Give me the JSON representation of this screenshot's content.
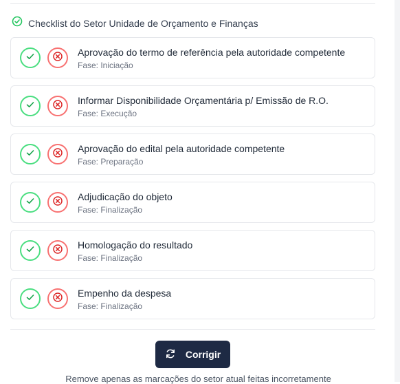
{
  "checklist": {
    "title": "Checklist do Setor Unidade de Orçamento e Finanças",
    "items": [
      {
        "title": "Aprovação do termo de referência pela autoridade competente",
        "phase": "Fase: Iniciação"
      },
      {
        "title": "Informar Disponibilidade Orçamentária p/ Emissão de R.O.",
        "phase": "Fase: Execução"
      },
      {
        "title": "Aprovação do edital pela autoridade competente",
        "phase": "Fase: Preparação"
      },
      {
        "title": "Adjudicação do objeto",
        "phase": "Fase: Finalização"
      },
      {
        "title": "Homologação do resultado",
        "phase": "Fase: Finalização"
      },
      {
        "title": "Empenho da despesa",
        "phase": "Fase: Finalização"
      }
    ]
  },
  "actions": {
    "corrigir_label": "Corrigir",
    "helper_text": "Remove apenas as marcações do setor atual feitas incorretamente"
  },
  "colors": {
    "approve": "#4ade80",
    "reject": "#f87171",
    "primary_button": "#1e2a44"
  },
  "icons": {
    "header": "circle-check-icon",
    "approve": "check-icon",
    "reject": "x-circle-icon",
    "corrigir": "refresh-icon"
  }
}
